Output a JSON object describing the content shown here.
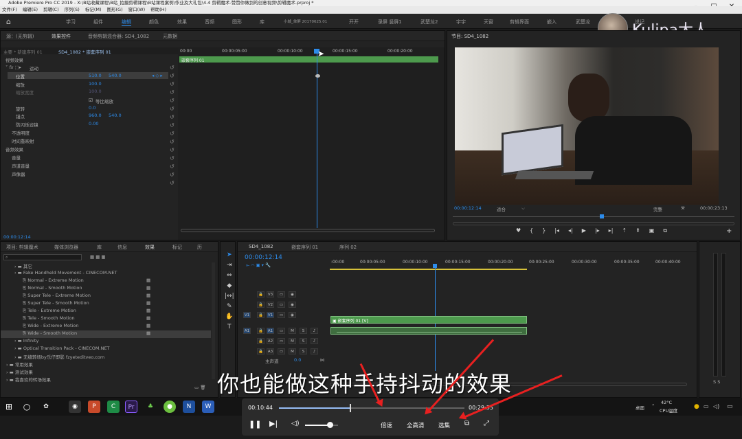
{
  "app": {
    "title": "Adobe Premiere Pro CC 2019 - X:\\B站收藏课程\\B站_拍摄剪辑课程\\B站课程案例\\作业及大礼包\\4.4 剪辑魔术-赞赞你做到的创意视频\\剪辑魔术.prproj *",
    "menu": [
      "文件(F)",
      "编辑(E)",
      "剪辑(C)",
      "序列(S)",
      "标记(M)",
      "图形(G)",
      "窗口(W)",
      "帮助(H)"
    ]
  },
  "workspaces": {
    "home_icon": "home-icon",
    "items": [
      "学习",
      "组件",
      "编辑",
      "颜色",
      "效果",
      "音频",
      "图形",
      "库",
      "小城_单屏 20170625.01",
      "开开",
      "录屏 竖屏1",
      "武楚龙2",
      "宇宇",
      "天窗",
      "剪辑界面",
      "嵌入",
      "武楚龙",
      "说记"
    ],
    "active": "编辑"
  },
  "watermark": {
    "text": "Kulipa大人"
  },
  "effect_controls": {
    "tabs": [
      "源：(无剪辑)",
      "效果控件",
      "音频剪辑混合器: SD4_1082",
      "元数据"
    ],
    "active_tab": "效果控件",
    "source_label": "主要 * 新建序列 01",
    "clip_label": "SD4_1082 * 嵌套序列 01",
    "section_video": "视频效果",
    "motion": "运动",
    "position": {
      "label": "位置",
      "x": "510.0",
      "y": "540.0"
    },
    "scale": {
      "label": "缩放",
      "value": "100.0"
    },
    "scale_width": {
      "label": "缩放宽度",
      "value": "100.0"
    },
    "uniform_scale": "等比缩放",
    "rotation": {
      "label": "旋转",
      "value": "0.0"
    },
    "anchor": {
      "label": "锚点",
      "x": "960.0",
      "y": "540.0"
    },
    "antiflicker": {
      "label": "防闪烁滤镜",
      "value": "0.00"
    },
    "opacity": "不透明度",
    "time_remap": "时间重映射",
    "section_audio": "音频效果",
    "volume": "音量",
    "channel_volume": "声道音量",
    "panner": "声像器",
    "ruler": [
      "00:00",
      "00:00:05:00",
      "00:00:10:00",
      "00:00:15:00",
      "00:00:20:00"
    ],
    "clip_bar": "嵌套序列 01",
    "timecode": "00:00:12:14"
  },
  "program_monitor": {
    "title": "节目: SD4_1082",
    "timecode_left": "00:00:12:14",
    "fit": "适合",
    "quality": "完整",
    "timecode_right": "00:00:23:13"
  },
  "project_panel": {
    "tabs": [
      "项目: 剪辑魔术",
      "媒体浏览器",
      "库",
      "信息",
      "效果",
      "标记",
      "历"
    ],
    "active_tab": "效果",
    "items": [
      {
        "label": "其它",
        "indent": 1
      },
      {
        "label": "Fake Handheld Movement - CINECOM.NET",
        "indent": 1
      },
      {
        "label": "Normal - Extreme Motion",
        "indent": 2
      },
      {
        "label": "Normal - Smooth Motion",
        "indent": 2
      },
      {
        "label": "Super Tele - Extreme Motion",
        "indent": 2
      },
      {
        "label": "Super Tele - Smooth Motion",
        "indent": 2
      },
      {
        "label": "Tele - Extreme Motion",
        "indent": 2
      },
      {
        "label": "Tele - Smooth Motion",
        "indent": 2
      },
      {
        "label": "Wide - Extreme Motion",
        "indent": 2
      },
      {
        "label": "Wide - Smooth Motion",
        "indent": 2
      },
      {
        "label": "Infinity",
        "indent": 1
      },
      {
        "label": "Optical Transition Pack - CINECOM.NET",
        "indent": 1
      },
      {
        "label": "无缝转场by乐仔即影 fzyeteditveo.com",
        "indent": 1
      },
      {
        "label": "常用效果",
        "indent": 0
      },
      {
        "label": "测试效果",
        "indent": 0
      },
      {
        "label": "我喜欢的转场效果",
        "indent": 0
      }
    ],
    "selected": "Wide - Smooth Motion"
  },
  "timeline": {
    "tabs": [
      "SD4_1082",
      "嵌套序列 01",
      "序列 02"
    ],
    "timecode": "00:00:12:14",
    "ruler": [
      ":00:00",
      "00:00:05:00",
      "00:00:10:00",
      "00:00:15:00",
      "00:00:20:00",
      "00:00:25:00",
      "00:00:30:00",
      "00:00:35:00",
      "00:00:40:00"
    ],
    "tracks": [
      "V3",
      "V2",
      "V1",
      "A1",
      "A2",
      "A3"
    ],
    "source_v": "V1",
    "source_a": "A1",
    "clip_video": "嵌套序列 01 [V]",
    "master": "主声道",
    "master_value": "0.0"
  },
  "subtitle": {
    "text": "你也能做这种手持抖动的效果"
  },
  "player": {
    "time_current": "00:10:44",
    "time_total": "00:29:35",
    "progress": 0.38,
    "volume": 0.75,
    "speed_label": "倍速",
    "quality_label": "全高清",
    "episodes_label": "选集"
  },
  "taskbar": {
    "desktop_label": "桌面",
    "temp": "42°C",
    "cpu_label": "CPU温度"
  },
  "colors": {
    "accent": "#2d8ceb",
    "clip_green": "#4d9a4d",
    "arrow_red": "#e82020"
  }
}
